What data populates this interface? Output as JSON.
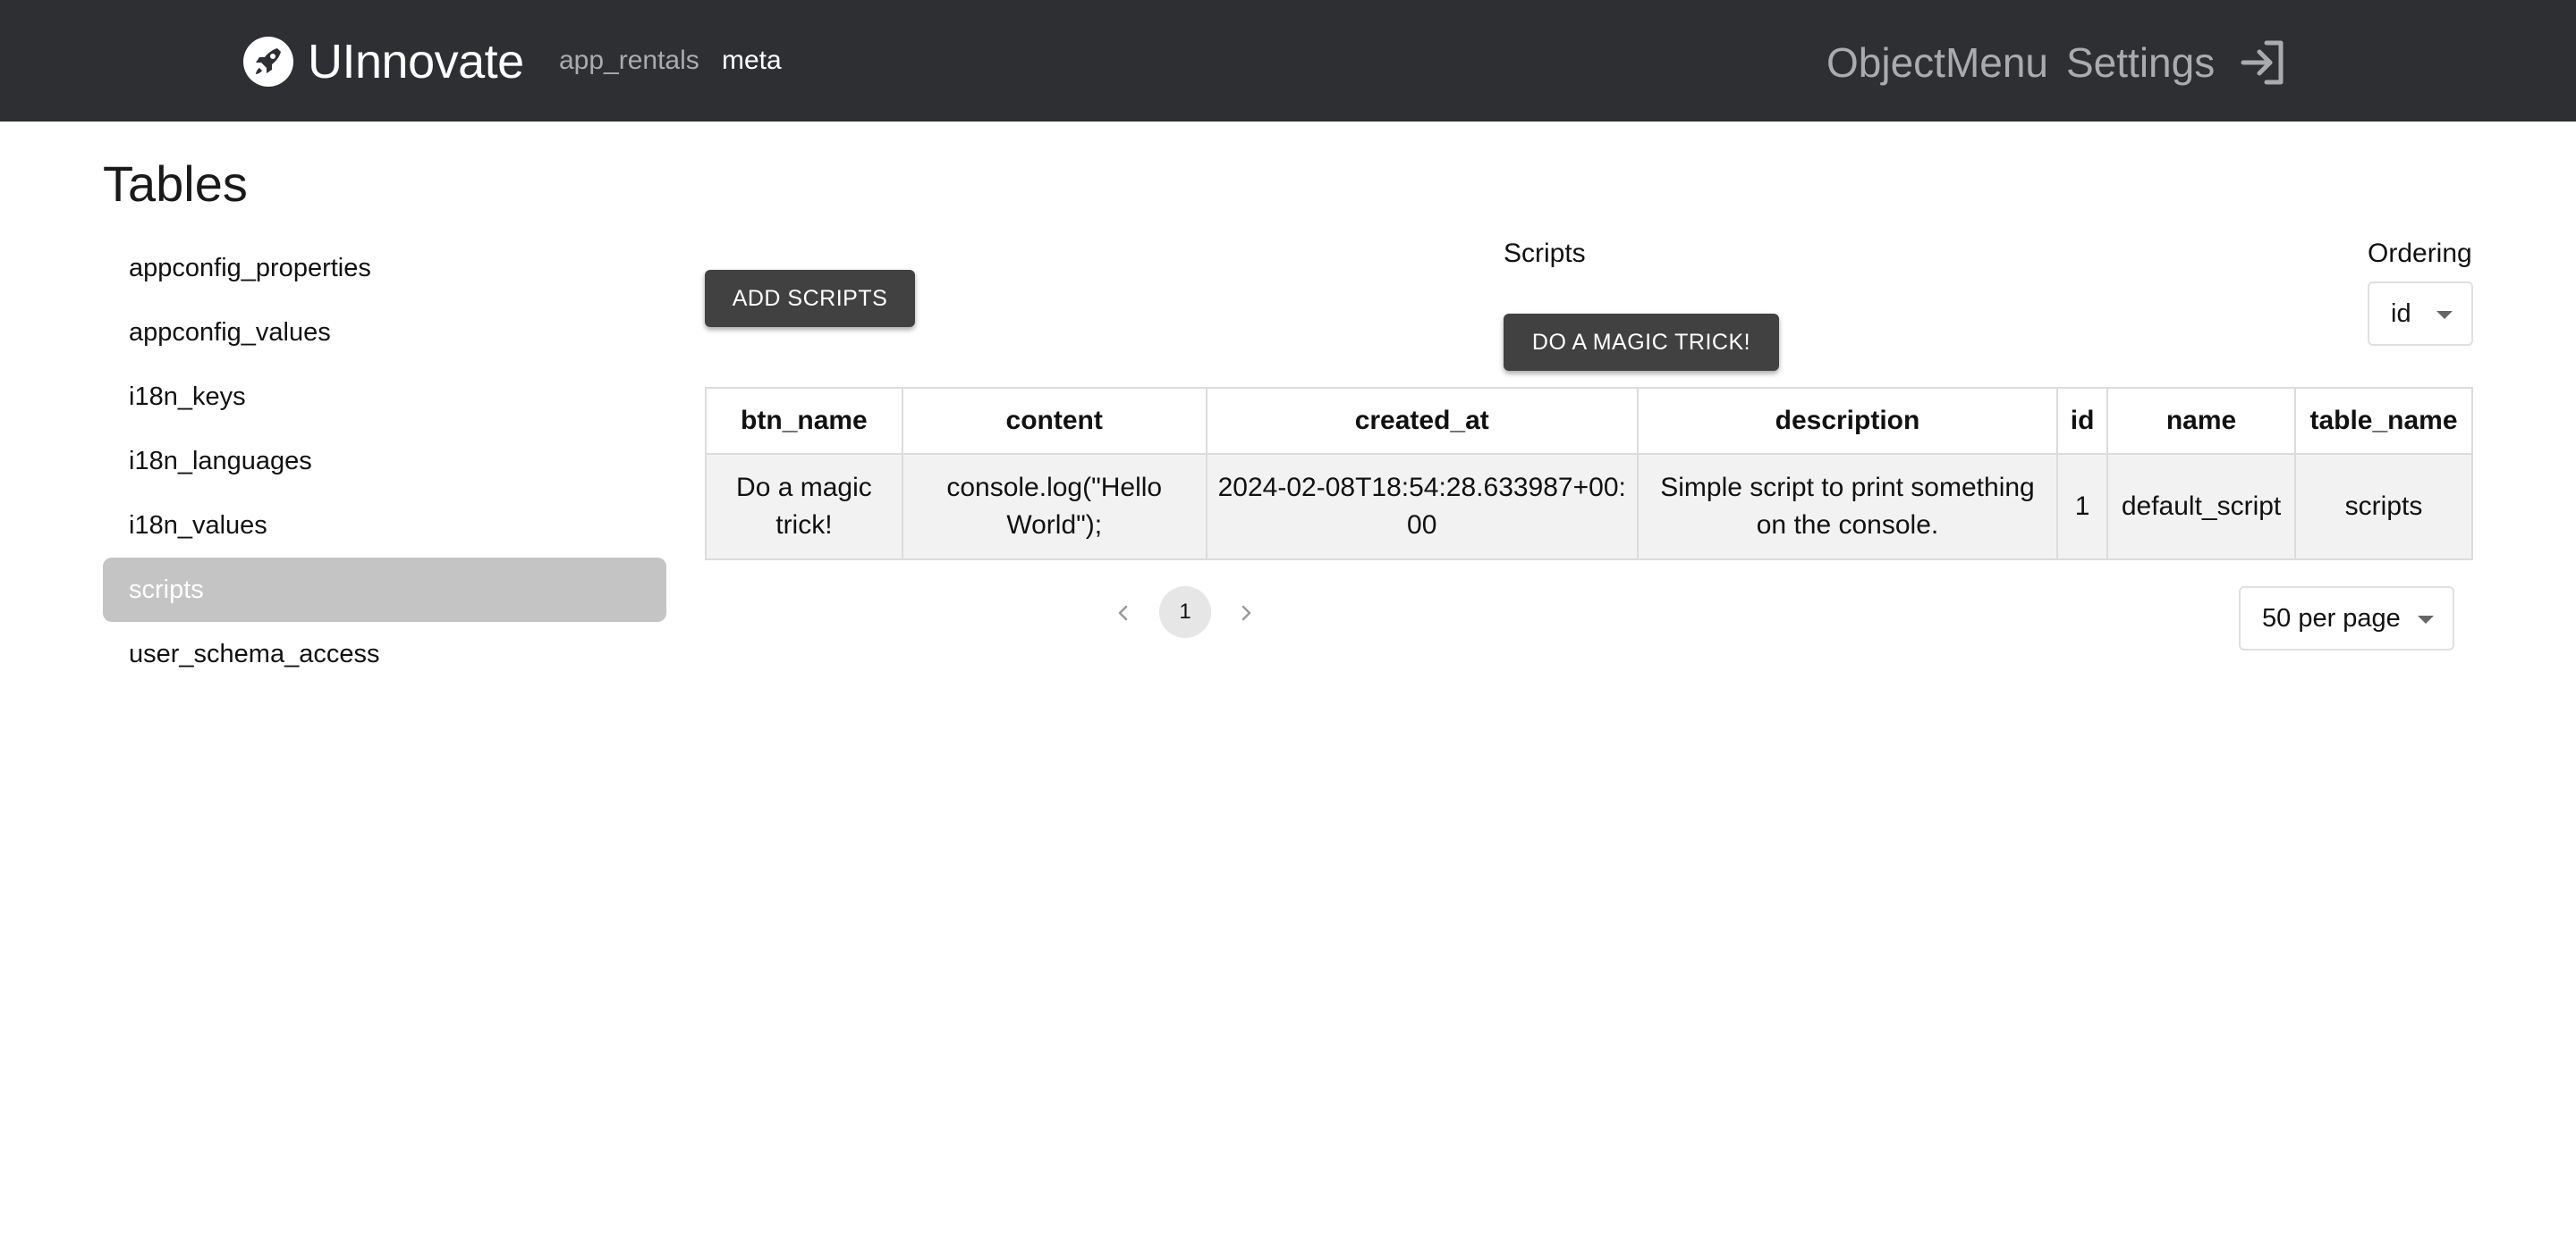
{
  "header": {
    "brand_name": "UInnovate",
    "schemas": [
      {
        "label": "app_rentals",
        "active": false
      },
      {
        "label": "meta",
        "active": true
      }
    ],
    "nav": {
      "object_menu": "ObjectMenu",
      "settings": "Settings"
    },
    "icons": {
      "logo": "rocket-logo-icon",
      "logout": "logout-icon"
    },
    "colors": {
      "bar": "#2d2f32",
      "inactive": "#a9abae",
      "active": "#ffffff"
    }
  },
  "sidebar": {
    "title": "Tables",
    "items": [
      {
        "label": "appconfig_properties",
        "selected": false
      },
      {
        "label": "appconfig_values",
        "selected": false
      },
      {
        "label": "i18n_keys",
        "selected": false
      },
      {
        "label": "i18n_languages",
        "selected": false
      },
      {
        "label": "i18n_values",
        "selected": false
      },
      {
        "label": "scripts",
        "selected": true
      },
      {
        "label": "user_schema_access",
        "selected": false
      }
    ]
  },
  "main": {
    "add_button": "ADD SCRIPTS",
    "scripts_label": "Scripts",
    "script_button": "DO A MAGIC TRICK!",
    "ordering": {
      "label": "Ordering",
      "value": "id"
    },
    "table": {
      "columns": [
        "btn_name",
        "content",
        "created_at",
        "description",
        "id",
        "name",
        "table_name"
      ],
      "rows": [
        [
          "Do a magic trick!",
          "console.log(\"Hello World\");",
          "2024-02-08T18:54:28.633987+00:00",
          "Simple script to print something on the console.",
          "1",
          "default_script",
          "scripts"
        ]
      ]
    },
    "pagination": {
      "current_page": "1",
      "per_page": "50 per page",
      "icons": {
        "prev": "chevron-left-icon",
        "next": "chevron-right-icon"
      }
    }
  }
}
